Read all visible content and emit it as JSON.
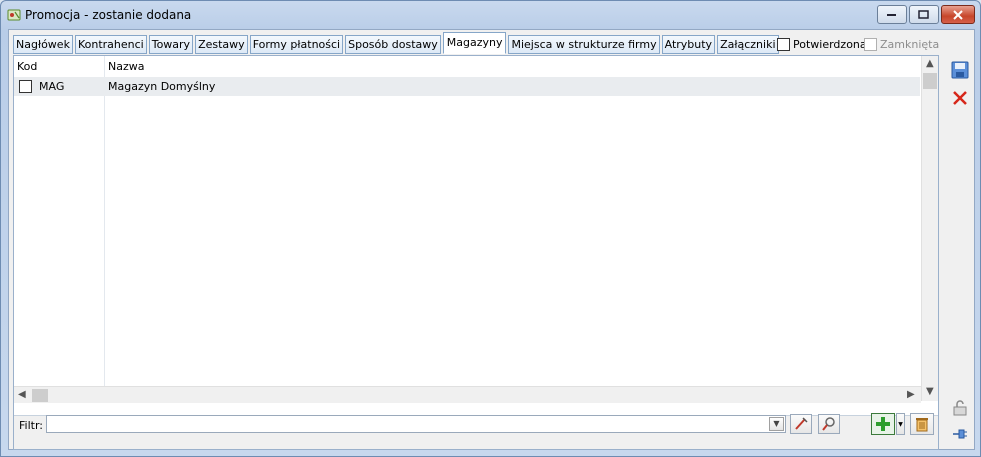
{
  "window": {
    "title": "Promocja - zostanie dodana"
  },
  "tabs": [
    {
      "label": "Nagłówek",
      "active": false
    },
    {
      "label": "Kontrahenci",
      "active": false
    },
    {
      "label": "Towary",
      "active": false
    },
    {
      "label": "Zestawy",
      "active": false
    },
    {
      "label": "Formy płatności",
      "active": false
    },
    {
      "label": "Sposób dostawy",
      "active": false
    },
    {
      "label": "Magazyny",
      "active": true
    },
    {
      "label": "Miejsca w strukturze firmy",
      "active": false
    },
    {
      "label": "Atrybuty",
      "active": false
    },
    {
      "label": "Załączniki",
      "active": false
    }
  ],
  "status": {
    "confirmed_label": "Potwierdzona",
    "closed_label": "Zamknięta"
  },
  "grid": {
    "columns": [
      "Kod",
      "Nazwa"
    ],
    "rows": [
      {
        "kod": "MAG",
        "nazwa": "Magazyn Domyślny"
      }
    ]
  },
  "filter": {
    "label": "Filtr:",
    "value": ""
  },
  "icons": {
    "save": "save-icon",
    "cancel": "close-icon",
    "lock": "lock-icon",
    "pin": "pin-icon"
  },
  "colors": {
    "accent": "#3a7bd5",
    "delete_red": "#d6271a",
    "add_green": "#2e9e2e"
  }
}
